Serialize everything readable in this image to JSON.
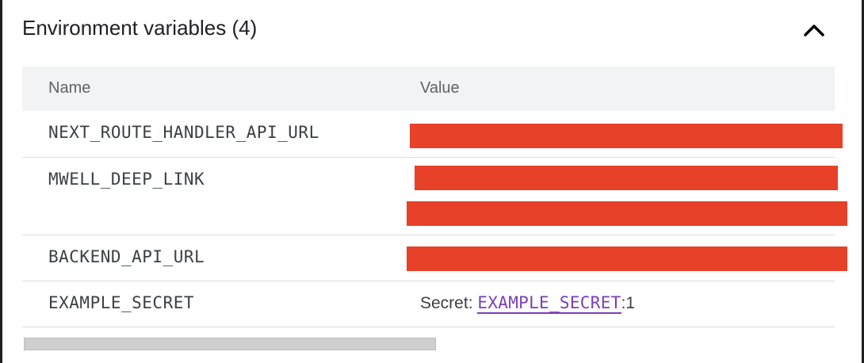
{
  "section": {
    "title": "Environment variables (4)",
    "collapse_icon": "chevron-up-icon"
  },
  "table": {
    "columns": {
      "name": "Name",
      "value": "Value"
    },
    "rows": [
      {
        "name": "NEXT_ROUTE_HANDLER_API_URL"
      },
      {
        "name": "MWELL_DEEP_LINK"
      },
      {
        "name": "BACKEND_API_URL"
      },
      {
        "name": "EXAMPLE_SECRET",
        "value_prefix": "Secret:",
        "secret_name": "EXAMPLE_SECRET",
        "secret_version": ":1"
      }
    ]
  },
  "colors": {
    "redaction": "#e8412a",
    "link": "#7b3fb5"
  }
}
